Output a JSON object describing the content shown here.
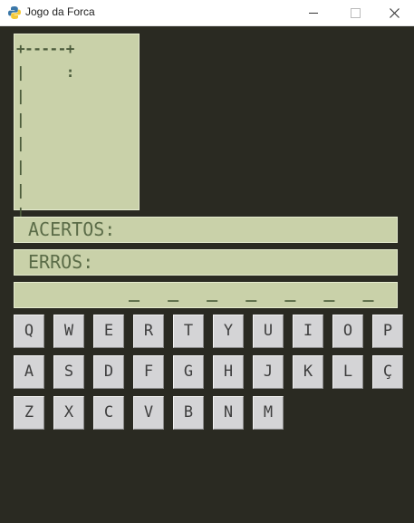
{
  "window": {
    "title": "Jogo da Forca"
  },
  "gallows": {
    "ascii": "+-----+\n|     :\n|\n|\n|\n|\n|\n|"
  },
  "hits": {
    "label": "ACERTOS:"
  },
  "errors": {
    "label": "ERROS:"
  },
  "word": {
    "display": "_ _ _ _ _ _ _"
  },
  "keyboard": {
    "rows": [
      [
        "Q",
        "W",
        "E",
        "R",
        "T",
        "Y",
        "U",
        "I",
        "O",
        "P"
      ],
      [
        "A",
        "S",
        "D",
        "F",
        "G",
        "H",
        "J",
        "K",
        "L",
        "Ç"
      ],
      [
        "Z",
        "X",
        "C",
        "V",
        "B",
        "N",
        "M"
      ]
    ]
  },
  "colors": {
    "background": "#2a2a22",
    "panel": "#c9d1a9",
    "panel_text": "#5b6c48",
    "key_face": "#d4d4d6"
  }
}
